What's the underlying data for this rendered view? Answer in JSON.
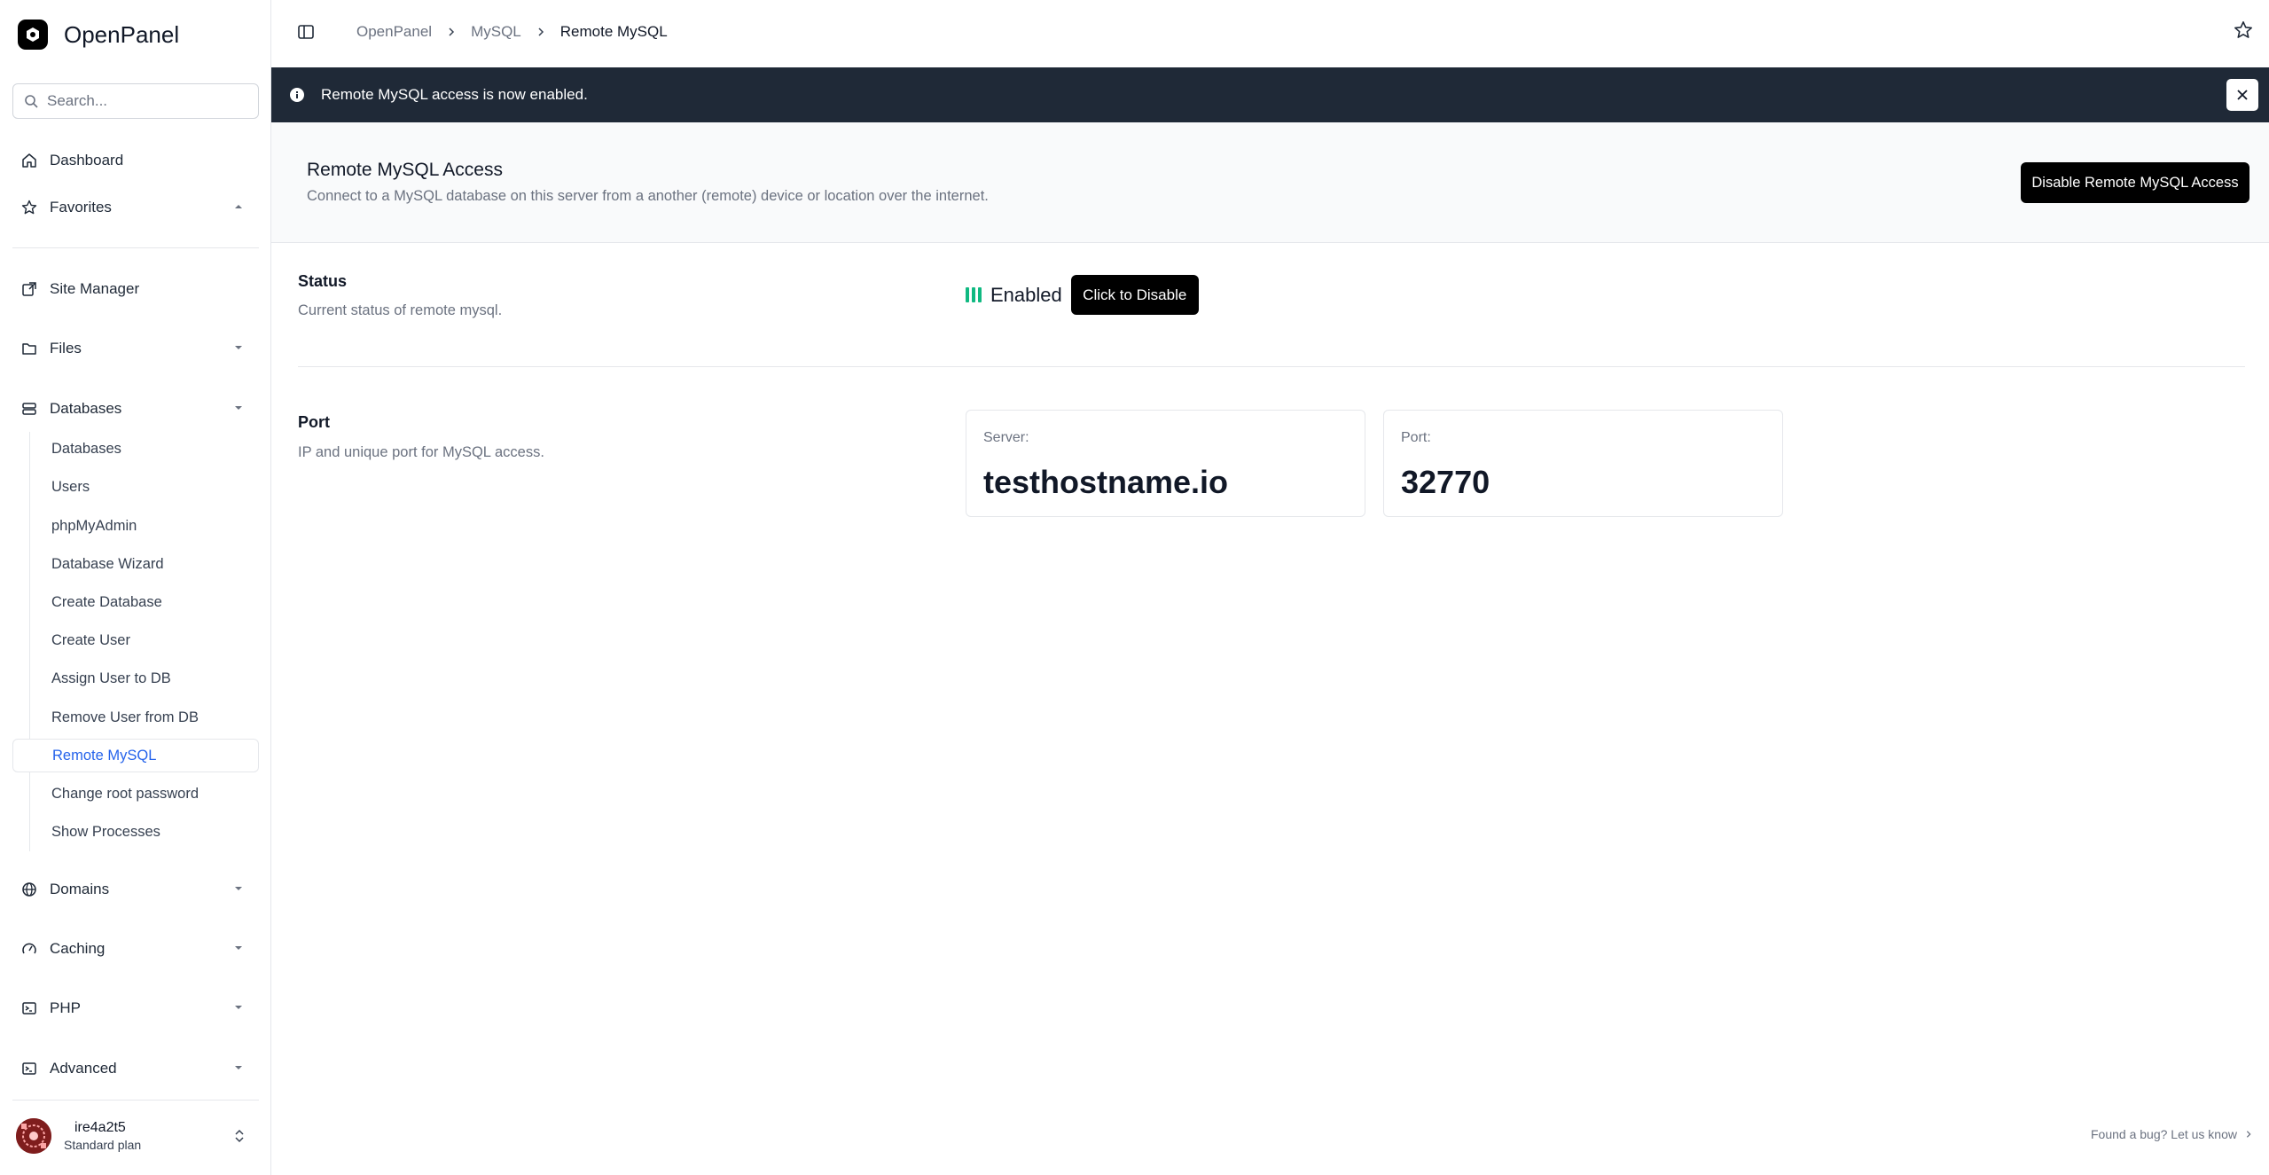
{
  "app": {
    "name": "OpenPanel"
  },
  "search": {
    "placeholder": "Search..."
  },
  "sidebar": {
    "dashboard": "Dashboard",
    "favorites": "Favorites",
    "site_manager": "Site Manager",
    "files": "Files",
    "databases": "Databases",
    "database_items": [
      "Databases",
      "Users",
      "phpMyAdmin",
      "Database Wizard",
      "Create Database",
      "Create User",
      "Assign User to DB",
      "Remove User from DB",
      "Remote MySQL",
      "Change root password",
      "Show Processes"
    ],
    "domains": "Domains",
    "caching": "Caching",
    "php": "PHP",
    "advanced": "Advanced"
  },
  "user": {
    "name": "ire4a2t5",
    "plan": "Standard plan"
  },
  "breadcrumb": [
    "OpenPanel",
    "MySQL",
    "Remote MySQL"
  ],
  "alert": {
    "message": "Remote MySQL access is now enabled."
  },
  "header": {
    "title": "Remote MySQL Access",
    "description": "Connect to a MySQL database on this server from a another (remote) device or location over the internet.",
    "disable_button": "Disable Remote MySQL Access"
  },
  "status": {
    "title": "Status",
    "description": "Current status of remote mysql.",
    "value": "Enabled",
    "toggle_button": "Click to Disable"
  },
  "port": {
    "title": "Port",
    "description": "IP and unique port for MySQL access.",
    "server_label": "Server:",
    "server_value": "testhostname.io",
    "port_label": "Port:",
    "port_value": "32770"
  },
  "footer": {
    "bug_link": "Found a bug? Let us know"
  },
  "colors": {
    "accent": "#2563eb",
    "status_green": "#10b981",
    "alert_bg": "#1f2937"
  }
}
